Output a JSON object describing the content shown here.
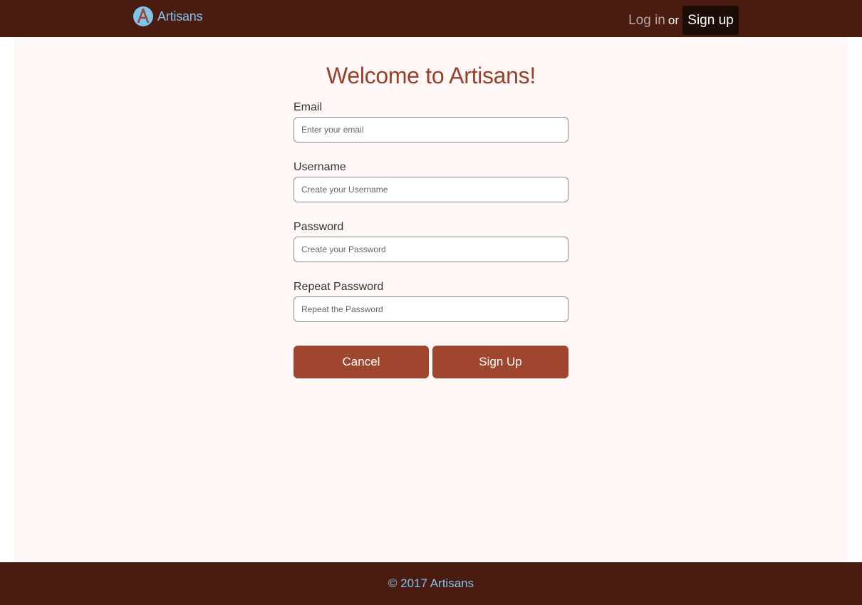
{
  "colors": {
    "nav_background": "#4a1c0f",
    "brand_link": "#7fc3ef",
    "page_background": "#fff8f6",
    "title": "#9a3f2a",
    "button": "#a0452e",
    "signup_nav_button": "#1c0c06"
  },
  "navbar": {
    "logo_icon": "artisans-logo-icon",
    "brand_name": "Artisans",
    "login_label": "Log in",
    "or_text": "or",
    "signup_label": "Sign up"
  },
  "main": {
    "title": "Welcome to Artisans!",
    "form": {
      "email": {
        "label": "Email",
        "value": "",
        "placeholder": "Enter your email"
      },
      "username": {
        "label": "Username",
        "value": "",
        "placeholder": "Create your Username"
      },
      "password": {
        "label": "Password",
        "value": "",
        "placeholder": "Create your Password"
      },
      "repeat_password": {
        "label": "Repeat Password",
        "value": "",
        "placeholder": "Repeat the Password"
      }
    },
    "buttons": {
      "cancel_label": "Cancel",
      "signup_label": "Sign Up"
    }
  },
  "footer": {
    "text": "© 2017 Artisans"
  }
}
